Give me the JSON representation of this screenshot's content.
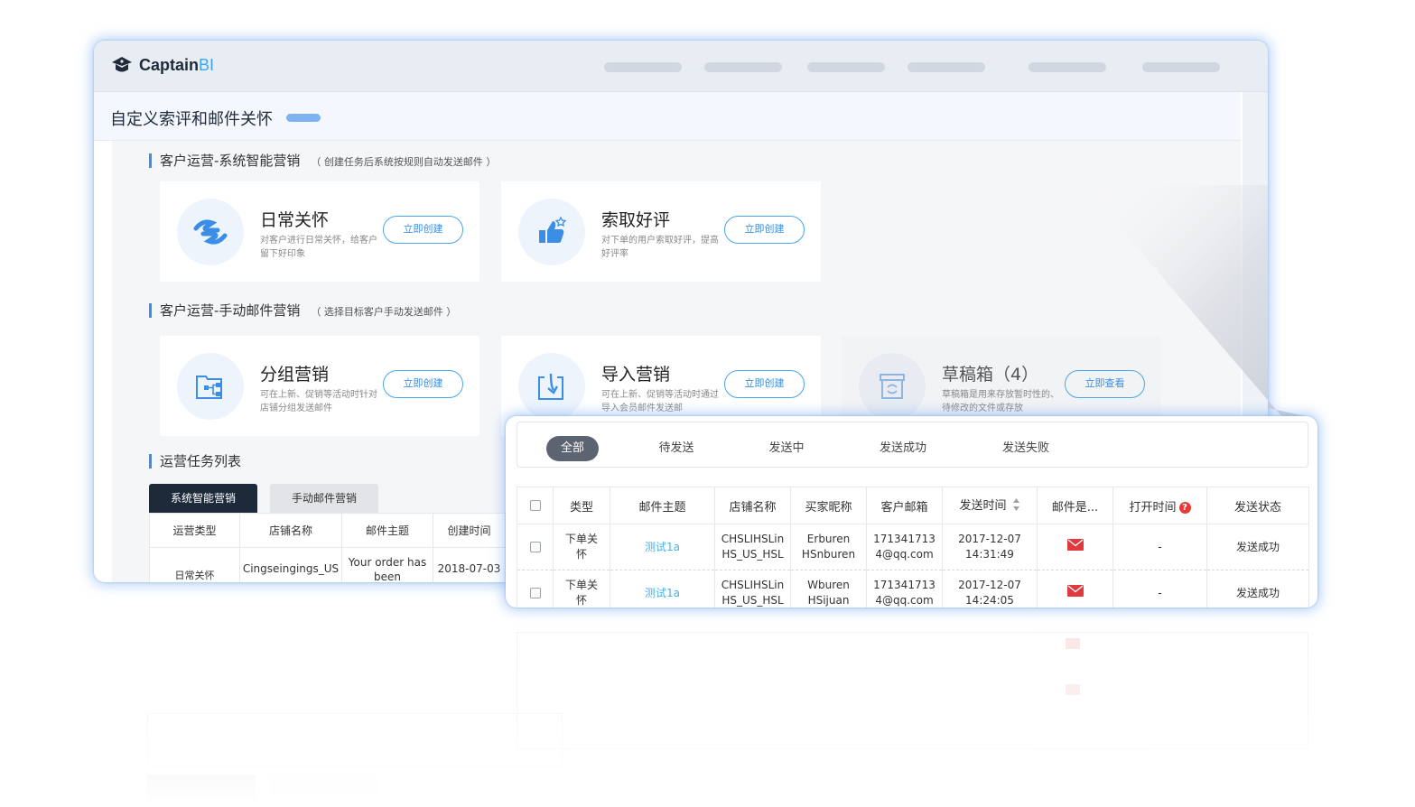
{
  "app": {
    "logo_text_main": "Captain",
    "logo_text_accent": "BI"
  },
  "page": {
    "title": "自定义索评和邮件关怀"
  },
  "sections": {
    "auto": {
      "title": "客户运营-系统智能营销",
      "subtitle": "（ 创建任务后系统按规则自动发送邮件 ）"
    },
    "manual": {
      "title": "客户运营-手动邮件营销",
      "subtitle": "（ 选择目标客户手动发送邮件 ）"
    },
    "tasks": {
      "title": "运营任务列表"
    }
  },
  "cards": [
    {
      "title": "日常关怀",
      "desc": "对客户进行日常关怀，给客户留下好印象",
      "button": "立即创建",
      "icon": "handshake-icon"
    },
    {
      "title": "索取好评",
      "desc": "对下单的用户索取好评，提高好评率",
      "button": "立即创建",
      "icon": "thumbs-up-icon"
    },
    {
      "title": "分组营销",
      "desc": "可在上新、促销等活动时针对店铺分组发送邮件",
      "button": "立即创建",
      "icon": "org-chart-icon"
    },
    {
      "title": "导入营销",
      "desc": "可在上新、促销等活动时通过导入会员邮件发送邮",
      "button": "立即创建",
      "icon": "import-icon"
    },
    {
      "title": "草稿箱（4）",
      "desc": "草稿箱是用来存放暂时性的、待修改的文件或存放",
      "button": "立即查看",
      "icon": "draft-box-icon"
    }
  ],
  "task_tabs": [
    "系统智能营销",
    "手动邮件营销"
  ],
  "task_table": {
    "headers": [
      "运营类型",
      "店铺名称",
      "邮件主题",
      "创建时间"
    ],
    "row": [
      "日常关怀",
      "Cingseingings_US",
      "Your order has been",
      "2018-07-03"
    ]
  },
  "email_panel": {
    "tabs": [
      "全部",
      "待发送",
      "发送中",
      "发送成功",
      "发送失败"
    ],
    "headers": [
      "",
      "类型",
      "邮件主题",
      "店铺名称",
      "买家昵称",
      "客户邮箱",
      "发送时间",
      "邮件是...",
      "打开时间",
      "发送状态"
    ],
    "help_badge": "?",
    "rows": [
      {
        "type": [
          "下单关",
          "怀"
        ],
        "subject": "测试1a",
        "shop": [
          "CHSLIHSLin",
          "HS_US_HSL"
        ],
        "buyer": [
          "Erburen",
          "HSnburen"
        ],
        "email": [
          "171341713",
          "4@qq.com"
        ],
        "time": [
          "2017-12-07",
          "14:31:49"
        ],
        "open_time": "-",
        "status": "发送成功"
      },
      {
        "type": [
          "下单关",
          "怀"
        ],
        "subject": "测试1a",
        "shop": [
          "CHSLIHSLin",
          "HS_US_HSL"
        ],
        "buyer": [
          "Wburen",
          "HSijuan"
        ],
        "email": [
          "171341713",
          "4@qq.com"
        ],
        "time": [
          "2017-12-07",
          "14:24:05"
        ],
        "open_time": "-",
        "status": "发送成功"
      }
    ]
  },
  "colors": {
    "accent": "#3a8ee6",
    "dark_tab": "#1d2a3a",
    "mail_icon": "#e0393e",
    "help_badge": "#e53935"
  }
}
